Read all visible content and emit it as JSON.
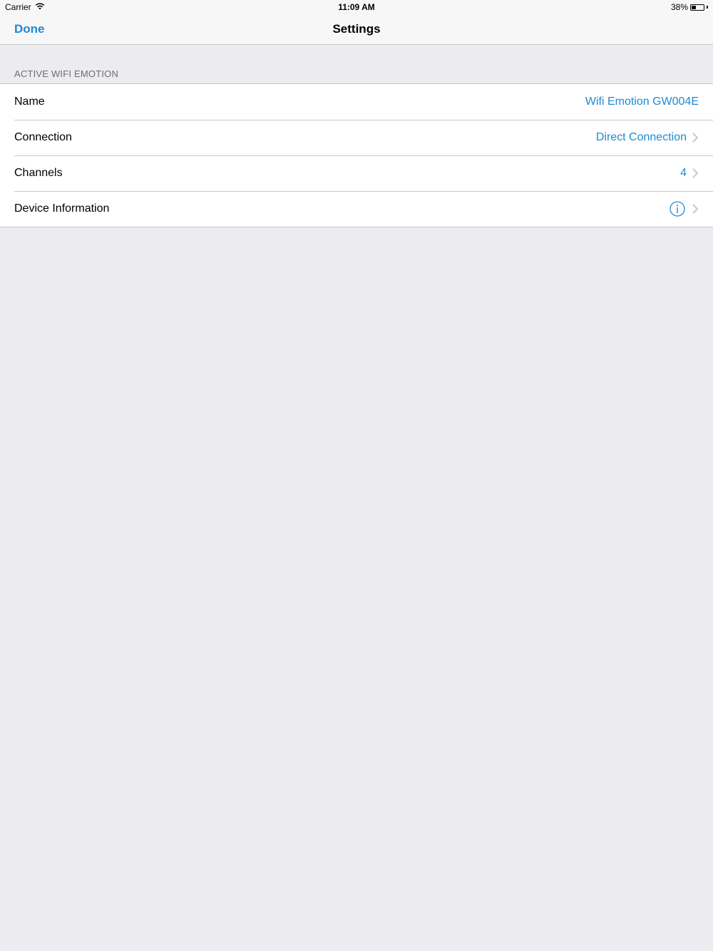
{
  "status_bar": {
    "carrier": "Carrier",
    "time": "11:09 AM",
    "battery_percent_text": "38%",
    "battery_level": 0.38,
    "icons": [
      "wifi-icon",
      "battery-icon"
    ]
  },
  "nav": {
    "done_label": "Done",
    "title": "Settings"
  },
  "section": {
    "header": "ACTIVE WIFI EMOTION"
  },
  "rows": [
    {
      "label": "Name",
      "value": "Wifi Emotion GW004E"
    },
    {
      "label": "Connection",
      "value": "Direct Connection"
    },
    {
      "label": "Channels",
      "value": "4"
    },
    {
      "label": "Device Information",
      "icon": "info-icon"
    }
  ],
  "colors": {
    "accent": "#1d8bd3",
    "background": "#ebebf0",
    "separator": "#c8c7cc",
    "section_header": "#6d6d72",
    "chevron": "#c7c7cc"
  }
}
